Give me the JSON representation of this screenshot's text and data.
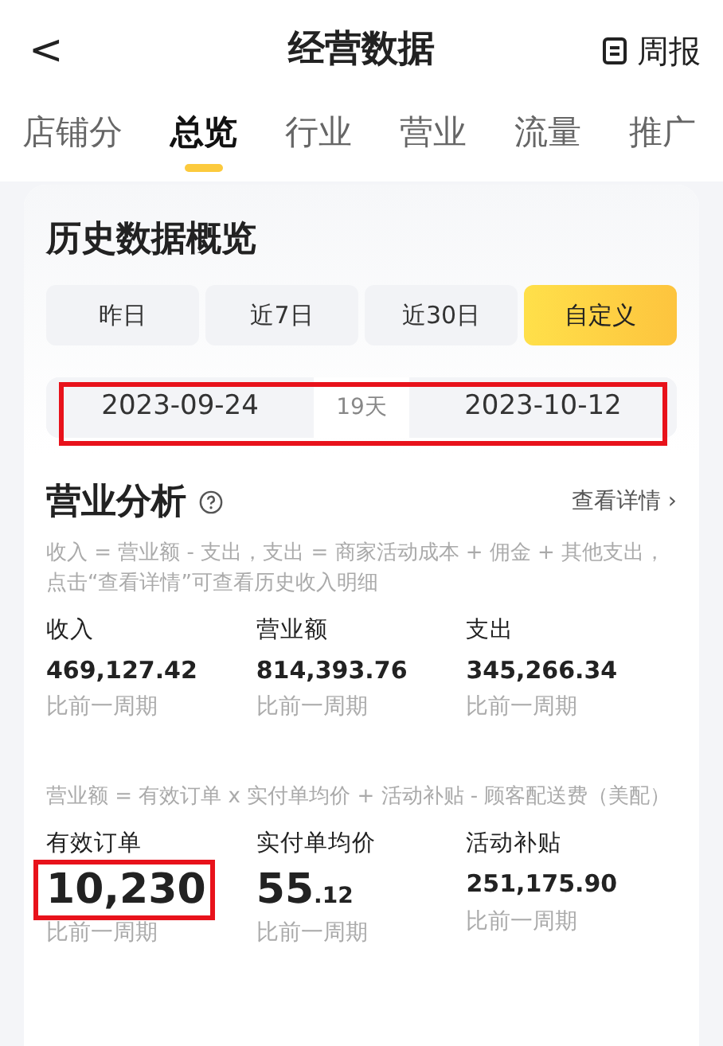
{
  "header": {
    "back": "<",
    "title": "经营数据",
    "action": "周报"
  },
  "tabs": [
    {
      "label": "店铺分",
      "selected": false
    },
    {
      "label": "总览",
      "selected": true
    },
    {
      "label": "行业",
      "selected": false
    },
    {
      "label": "营业",
      "selected": false
    },
    {
      "label": "流量",
      "selected": false
    },
    {
      "label": "推广",
      "selected": false
    }
  ],
  "history": {
    "title": "历史数据概览",
    "periods": [
      {
        "label": "昨日",
        "selected": false
      },
      {
        "label": "近7日",
        "selected": false
      },
      {
        "label": "近30日",
        "selected": false
      },
      {
        "label": "自定义",
        "selected": true
      }
    ],
    "date_range": {
      "start": "2023-09-24",
      "days": "19天",
      "end": "2023-10-12",
      "highlighted": true
    }
  },
  "analysis": {
    "title": "营业分析",
    "details_link": "查看详情 ›",
    "note": "收入 = 营业额 - 支出，支出 = 商家活动成本 + 佣金 + 其他支出，点击“查看详情”可查看历史收入明细",
    "metrics": [
      {
        "label": "收入",
        "value": "469,127.42",
        "compare": "比前一周期"
      },
      {
        "label": "营业额",
        "value": "814,393.76",
        "compare": "比前一周期"
      },
      {
        "label": "支出",
        "value": "345,266.34",
        "compare": "比前一周期"
      }
    ],
    "formula": "营业额 = 有效订单 x 实付单均价 + 活动补贴 - 顾客配送费（美配）",
    "order_metrics": [
      {
        "label": "有效订单",
        "value": "10,230",
        "kind": "large",
        "compare": "比前一周期",
        "highlighted": true
      },
      {
        "label": "实付单均价",
        "value": "55$_{.12}$",
        "kind": "large",
        "compare": "比前一周期",
        "highlighted": false
      },
      {
        "label": "活动补贴",
        "value": "251,175.90",
        "kind": "normal",
        "compare": "比前一周期",
        "highlighted": false
      }
    ]
  }
}
